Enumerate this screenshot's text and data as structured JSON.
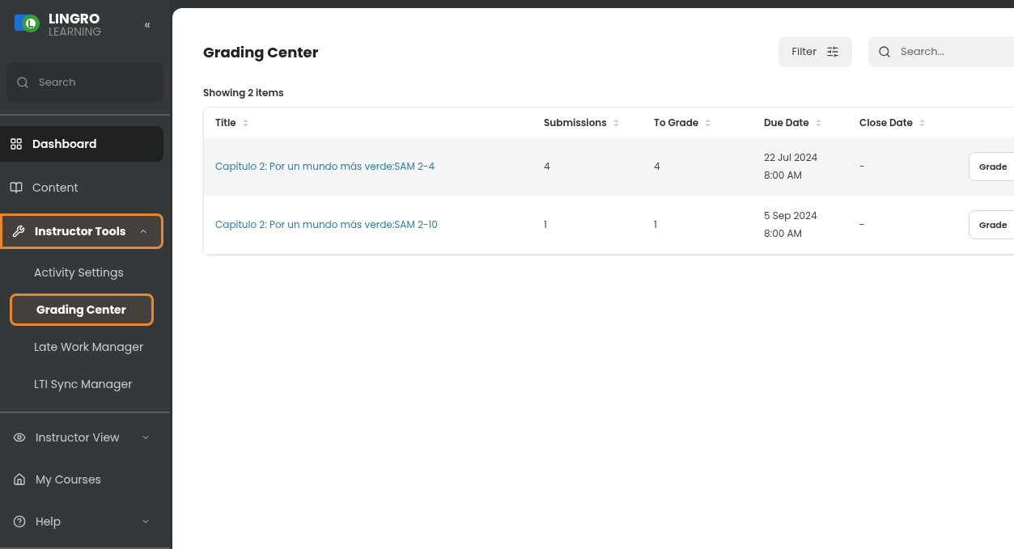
{
  "sidebar": {
    "logo": {
      "title": "LINGRO",
      "subtitle": "LEARNING"
    },
    "collapse_icon": "«",
    "search": {
      "placeholder": "Search"
    },
    "items": [
      {
        "label": "Dashboard",
        "kind": "grid",
        "selected": true,
        "highlighted": false
      },
      {
        "label": "Content",
        "kind": "book",
        "selected": false,
        "highlighted": false
      },
      {
        "label": "Instructor Tools",
        "kind": "tools",
        "selected": false,
        "highlighted": true,
        "expanded": true,
        "children": [
          {
            "label": "Activity Settings",
            "selected": false,
            "highlighted": false
          },
          {
            "label": "Grading Center",
            "selected": true,
            "highlighted": true
          },
          {
            "label": "Late Work Manager",
            "selected": false,
            "highlighted": false
          },
          {
            "label": "LTI Sync Manager",
            "selected": false,
            "highlighted": false
          }
        ]
      }
    ],
    "lower_items": [
      {
        "label": "Instructor View",
        "kind": "eye",
        "expanded": false
      },
      {
        "label": "My Courses",
        "kind": "home"
      },
      {
        "label": "Help",
        "kind": "help",
        "expanded": false
      }
    ]
  },
  "page": {
    "title": "Grading Center",
    "filter_button": "Filter",
    "search": {
      "placeholder": "Search..."
    },
    "count": "Showing 2 items"
  },
  "table": {
    "columns": [
      "Title",
      "Submissions",
      "To Grade",
      "Due Date",
      "Close Date"
    ],
    "rows": [
      {
        "title": "Capítulo 2: Por un mundo más verde:SAM 2-4",
        "submissions": "4",
        "to_grade": "4",
        "due_date": "22 Jul 2024",
        "due_time": "8:00 AM",
        "close_date": "-",
        "action": "Grade"
      },
      {
        "title": "Capítulo 2: Por un mundo más verde:SAM 2-10",
        "submissions": "1",
        "to_grade": "1",
        "due_date": "5 Sep 2024",
        "due_time": "8:00 AM",
        "close_date": "-",
        "action": "Grade"
      }
    ]
  }
}
